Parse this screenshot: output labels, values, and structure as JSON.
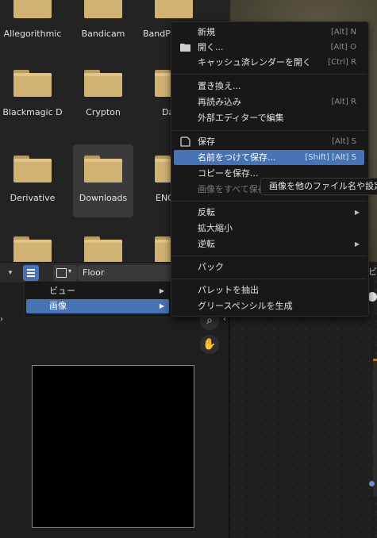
{
  "file_browser": {
    "items": [
      {
        "name": "Allegorithmic"
      },
      {
        "name": "Bandicam"
      },
      {
        "name": "BandPr"
      },
      {
        "name": "Blackmagic D"
      },
      {
        "name": "Crypton"
      },
      {
        "name": "Da"
      },
      {
        "name": "Derivative"
      },
      {
        "name": "Downloads",
        "selected": true
      },
      {
        "name": "ENC"
      },
      {
        "name": ""
      },
      {
        "name": ""
      },
      {
        "name": ""
      }
    ]
  },
  "image_editor": {
    "image_name": "Floor",
    "icons": [
      "chevron-down-icon",
      "hamburger-menu-icon",
      "image-icon",
      "zoom-icon",
      "hand-icon"
    ]
  },
  "view_menu": {
    "items": [
      {
        "label": "ビュー",
        "has_submenu": true
      },
      {
        "label": "画像",
        "has_submenu": true,
        "active": true
      }
    ]
  },
  "image_menu": {
    "items": [
      {
        "label": "新規",
        "shortcut": "[Alt] N"
      },
      {
        "label": "開く...",
        "shortcut": "[Alt] O",
        "icon": "folder-icon"
      },
      {
        "label": "キャッシュ済レンダーを開く",
        "shortcut": "[Ctrl] R"
      },
      {
        "label": "置き換え..."
      },
      {
        "label": "再読み込み",
        "shortcut": "[Alt] R"
      },
      {
        "label": "外部エディターで編集"
      },
      {
        "label": "保存",
        "shortcut": "[Alt] S",
        "icon": "save-icon"
      },
      {
        "label": "名前をつけて保存...",
        "shortcut": "[Shift] [Alt] S",
        "active": true
      },
      {
        "label": "コピーを保存..."
      },
      {
        "label": "画像をすべて保存",
        "disabled": true
      },
      {
        "label": "反転",
        "has_submenu": true
      },
      {
        "label": "拡大縮小"
      },
      {
        "label": "逆転",
        "has_submenu": true
      },
      {
        "label": "パック"
      },
      {
        "label": "パレットを抽出"
      },
      {
        "label": "グリースペンシルを生成"
      }
    ]
  },
  "tooltip": {
    "text": "画像を他のファイル名や設定"
  },
  "colors": {
    "accent": "#4772b3",
    "folder": "#d2b273",
    "menu_bg": "#181818"
  },
  "right_panel": {
    "top_glyph": "ビ"
  }
}
